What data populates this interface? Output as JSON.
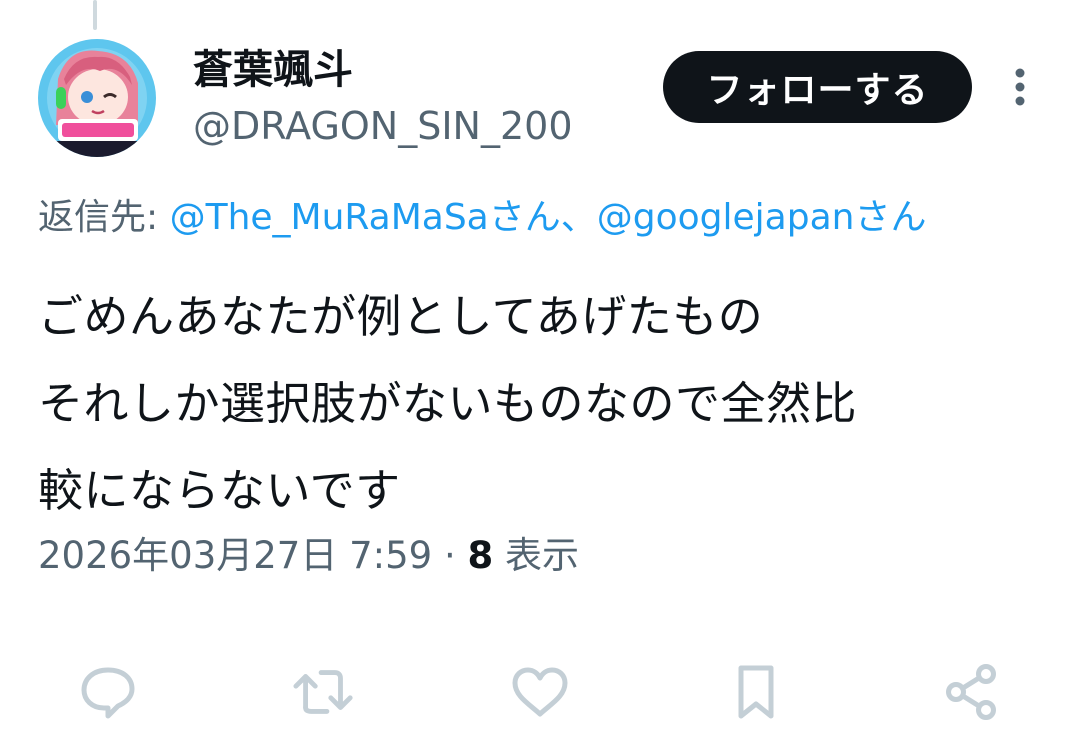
{
  "user": {
    "display_name": "蒼葉颯斗",
    "handle": "@DRAGON_SIN_200",
    "avatar_icon": "anime-character-avatar"
  },
  "follow_button": {
    "label": "フォローする"
  },
  "more_icon": "more-vertical-icon",
  "reply_to": {
    "label": "返信先:",
    "mentions": [
      "@The_MuRaMaSaさん",
      "@googlejapanさん"
    ],
    "separator": "、"
  },
  "tweet": {
    "lines": [
      "ごめんあなたが例としてあげたもの",
      "それしか選択肢がないものなので全然比",
      "較にならないです"
    ]
  },
  "meta": {
    "timestamp": "2026年03月27日 7:59",
    "dot": "·",
    "views_count": "8",
    "views_label": "表示"
  },
  "actions": [
    {
      "icon": "reply-icon"
    },
    {
      "icon": "retweet-icon"
    },
    {
      "icon": "like-icon"
    },
    {
      "icon": "bookmark-icon"
    },
    {
      "icon": "share-icon"
    }
  ],
  "colors": {
    "text_primary": "#0f1419",
    "text_secondary": "#536471",
    "link": "#1d9bf0",
    "icon_gray": "#c4cfd6",
    "button_bg": "#0f1419",
    "button_text": "#ffffff"
  }
}
